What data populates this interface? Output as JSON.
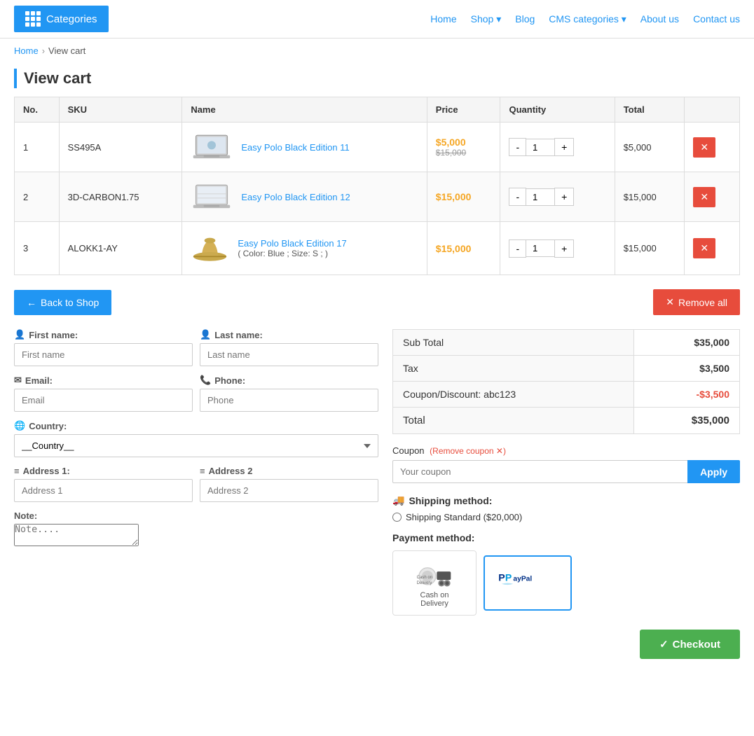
{
  "header": {
    "categories_label": "Categories",
    "nav": {
      "home": "Home",
      "shop": "Shop",
      "blog": "Blog",
      "cms": "CMS categories",
      "about": "About us",
      "contact": "Contact us"
    }
  },
  "breadcrumb": {
    "home": "Home",
    "current": "View cart"
  },
  "page_title": "View cart",
  "table": {
    "headers": [
      "No.",
      "SKU",
      "Name",
      "Price",
      "Quantity",
      "Total",
      ""
    ],
    "rows": [
      {
        "no": "1",
        "sku": "SS495A",
        "name": "Easy Polo Black Edition 11",
        "price_current": "$5,000",
        "price_original": "$15,000",
        "qty": "1",
        "total": "$5,000"
      },
      {
        "no": "2",
        "sku": "3D-CARBON1.75",
        "name": "Easy Polo Black Edition 12",
        "price_current": "$15,000",
        "price_original": "",
        "qty": "1",
        "total": "$15,000"
      },
      {
        "no": "3",
        "sku": "ALOKK1-AY",
        "name": "Easy Polo Black Edition 17",
        "name_sub": "( Color: Blue ; Size: S ; )",
        "price_current": "$15,000",
        "price_original": "",
        "qty": "1",
        "total": "$15,000"
      }
    ]
  },
  "actions": {
    "back_to_shop": "Back to Shop",
    "remove_all": "Remove all"
  },
  "form": {
    "first_name_label": "First name:",
    "first_name_placeholder": "First name",
    "last_name_label": "Last name:",
    "last_name_placeholder": "Last name",
    "email_label": "Email:",
    "email_placeholder": "Email",
    "phone_label": "Phone:",
    "phone_placeholder": "Phone",
    "country_label": "Country:",
    "country_default": "__Country__",
    "address1_label": "Address 1:",
    "address1_placeholder": "Address 1",
    "address2_label": "Address 2",
    "address2_placeholder": "Address 2",
    "note_label": "Note:",
    "note_placeholder": "Note...."
  },
  "summary": {
    "subtotal_label": "Sub Total",
    "subtotal_value": "$35,000",
    "tax_label": "Tax",
    "tax_value": "$3,500",
    "coupon_label": "Coupon/Discount: abc123",
    "coupon_value": "-$3,500",
    "total_label": "Total",
    "total_value": "$35,000"
  },
  "coupon": {
    "label": "Coupon",
    "remove_text": "(Remove coupon ✕)",
    "placeholder": "Your coupon",
    "apply_label": "Apply"
  },
  "shipping": {
    "title": "Shipping method:",
    "option": "Shipping Standard ($20,000)"
  },
  "payment": {
    "title": "Payment method:",
    "cod_line1": "Cash on",
    "cod_line2": "Delivery"
  },
  "checkout": {
    "label": "Checkout"
  }
}
